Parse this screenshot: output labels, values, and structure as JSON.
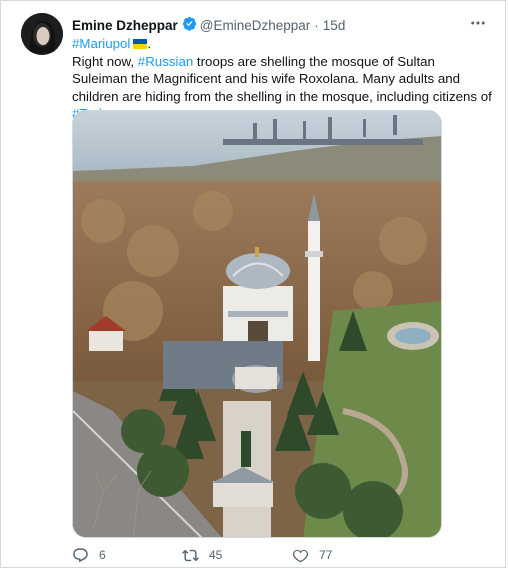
{
  "tweet": {
    "author_name": "Emine Dzheppar",
    "handle": "@EmineDzheppar",
    "separator": "·",
    "time": "15d",
    "hashtag1": "#Mariupol",
    "text_a": "Right now, ",
    "hashtag2": "#Russian",
    "text_b": " troops are shelling the mosque of Sultan Suleiman the Magnificent and his wife Roxolana.  Many adults and children are hiding from the shelling in the mosque, including  citizens of ",
    "hashtag3": "#Turkey",
    "text_c": "."
  },
  "actions": {
    "replies": "6",
    "retweets": "45",
    "likes": "77"
  },
  "colors": {
    "accent": "#1d9bf0",
    "secondary": "#536471",
    "border": "#cfd9de"
  },
  "icons": [
    "verified-badge-icon",
    "more-icon",
    "reply-icon",
    "retweet-icon",
    "like-icon"
  ]
}
